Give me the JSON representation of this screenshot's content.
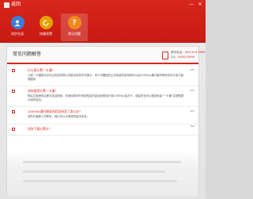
{
  "window": {
    "title": "返回"
  },
  "controls": {
    "minimize": "—",
    "close": "✕"
  },
  "nav": [
    {
      "label": "同步在局",
      "icon": "user-icon",
      "color": "#3b7fd6",
      "glyph": "●"
    },
    {
      "label": "快捷续费",
      "icon": "refresh-icon",
      "color": "#e6a100",
      "glyph": "⟳"
    },
    {
      "label": "常见问题",
      "icon": "question-icon",
      "color": "#f08a1c",
      "glyph": "?"
    }
  ],
  "panel": {
    "title": "常见问题解答",
    "contact": [
      {
        "label": "联系电话：",
        "value": "400-919-9999"
      },
      {
        "label": "QQ：",
        "value": "800015998"
      }
    ]
  },
  "faqs": [
    {
      "q": "什么是计费一卡通？",
      "a": "计费一卡通是北京亦云科技有限公司推出的软件充值卡，本卡可赠国内主流收费的游戏软件以及1000Vip通行服务等软件的计费与管理服务",
      "expanded": true
    },
    {
      "q": "如何使用计费一卡通？",
      "a": "购买正版授权后即可激活使用，在使用软件时请用相应的激活码登录计费1000Vip会员卡，或者您也可以登录安装“一卡通”并按照提示操作激活。",
      "expanded": true
    },
    {
      "q": "1000Vip通行服务的验证码丢了怎么办？",
      "a": "请您与客服人员联系，我们可以为您提供技术支持，",
      "expanded": true
    },
    {
      "q": "如何下载计费卡？",
      "a": "",
      "expanded": false
    }
  ]
}
